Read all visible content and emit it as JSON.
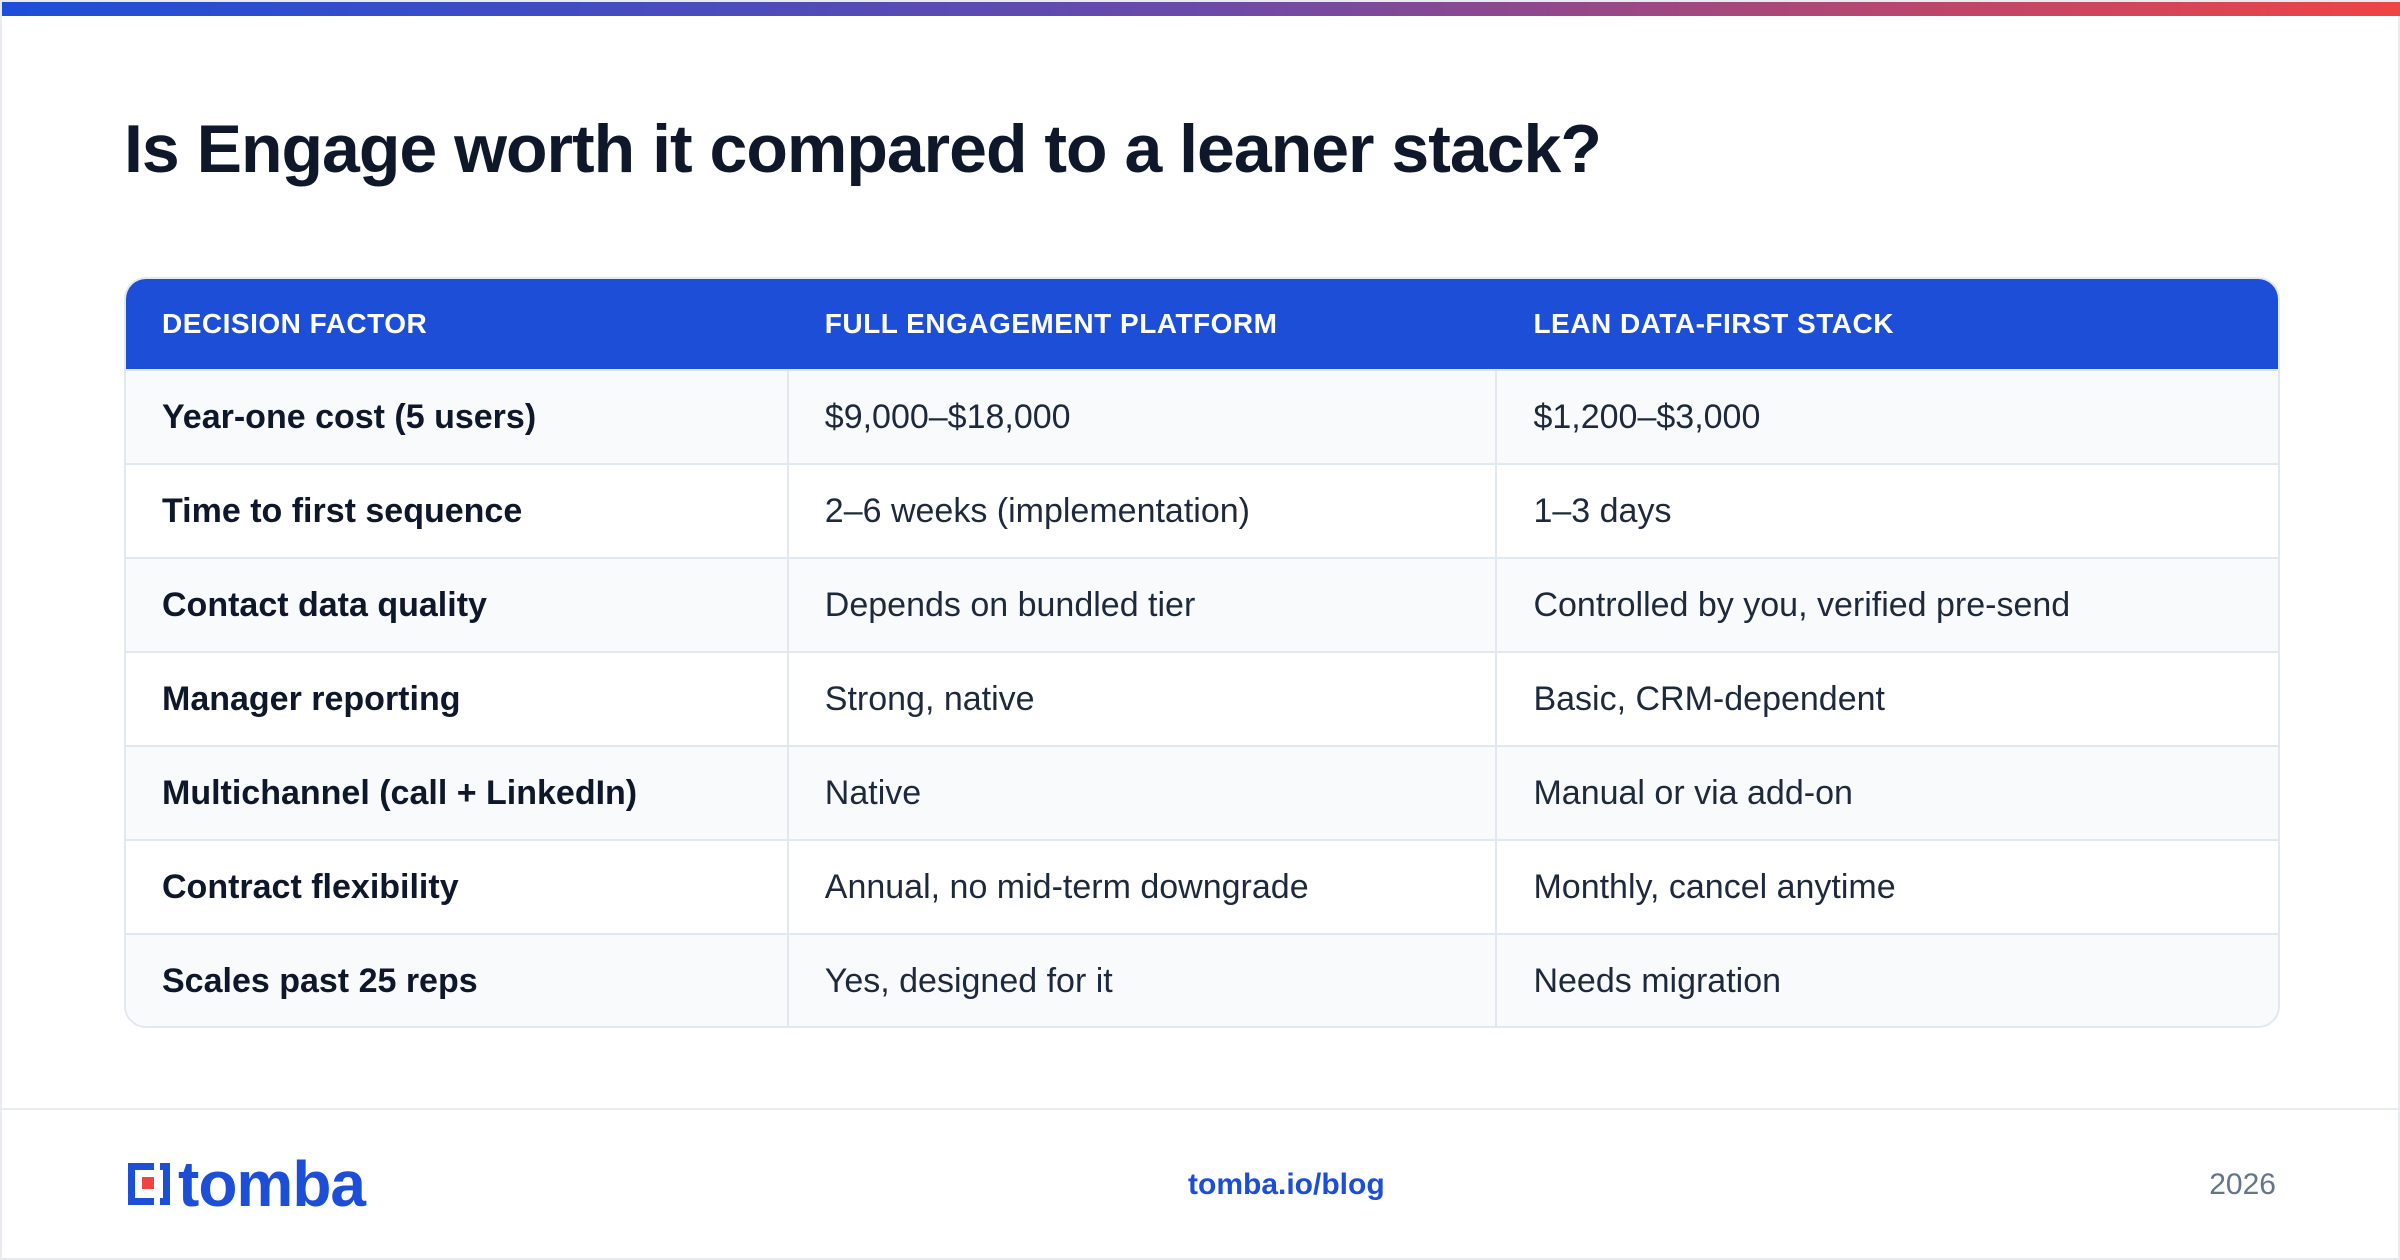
{
  "headline": "Is Engage worth it compared to a leaner stack?",
  "table": {
    "headers": [
      "DECISION FACTOR",
      "FULL ENGAGEMENT PLATFORM",
      "LEAN DATA-FIRST STACK"
    ],
    "rows": [
      [
        "Year-one cost (5 users)",
        "$9,000–$18,000",
        "$1,200–$3,000"
      ],
      [
        "Time to first sequence",
        "2–6 weeks (implementation)",
        "1–3 days"
      ],
      [
        "Contact data quality",
        "Depends on bundled tier",
        "Controlled by you, verified pre-send"
      ],
      [
        "Manager reporting",
        "Strong, native",
        "Basic, CRM-dependent"
      ],
      [
        "Multichannel (call + LinkedIn)",
        "Native",
        "Manual or via add-on"
      ],
      [
        "Contract flexibility",
        "Annual, no mid-term downgrade",
        "Monthly, cancel anytime"
      ],
      [
        "Scales past 25 reps",
        "Yes, designed for it",
        "Needs migration"
      ]
    ]
  },
  "footer": {
    "logo_text": "tomba",
    "url": "tomba.io/blog",
    "year": "2026"
  },
  "colors": {
    "brand_blue": "#1d4ed8",
    "gradient_start": "#1d4ed8",
    "gradient_end": "#ef4444",
    "logo_accent": "#ef4444"
  }
}
